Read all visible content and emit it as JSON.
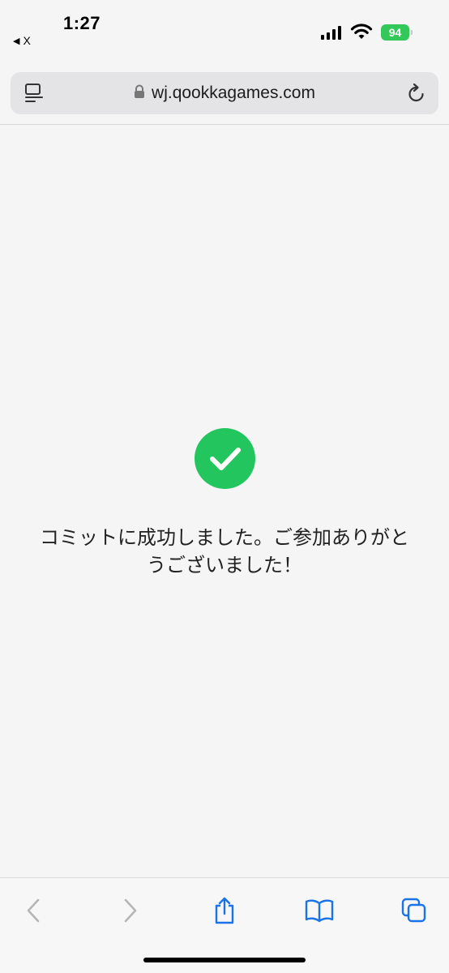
{
  "status_bar": {
    "time": "1:27",
    "back_app_label": "X",
    "battery_level": "94"
  },
  "browser": {
    "url": "wj.qookkagames.com",
    "icons": {
      "reader": "reader-icon",
      "lock": "lock-icon",
      "reload": "reload-icon"
    }
  },
  "content": {
    "success_icon": "checkmark-icon",
    "message": "コミットに成功しました。ご参加ありがとうございました！"
  },
  "toolbar": {
    "buttons": [
      "back-icon",
      "forward-icon",
      "share-icon",
      "bookmarks-icon",
      "tabs-icon"
    ]
  },
  "colors": {
    "success_green": "#22c55e",
    "battery_green": "#34c759",
    "accent_blue": "#1a73e8",
    "disabled_gray": "#b5b5b5",
    "background": "#f5f5f5"
  }
}
